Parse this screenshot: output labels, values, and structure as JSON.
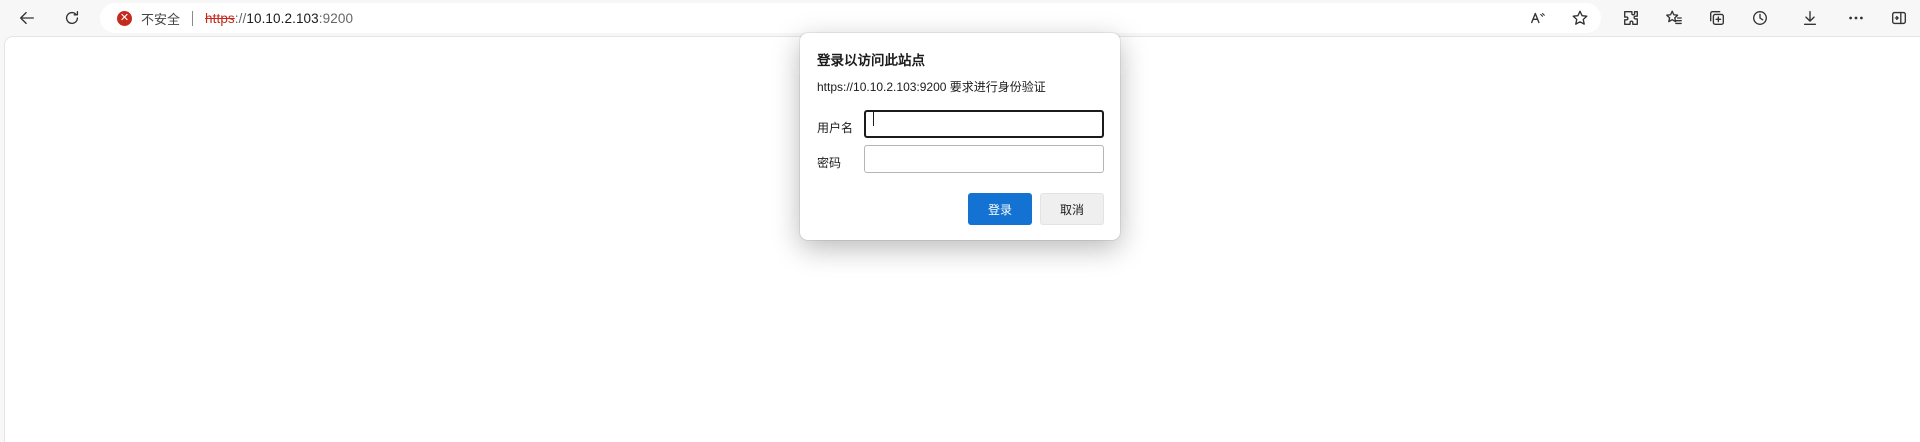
{
  "toolbar": {
    "back": "back-arrow-icon",
    "refresh": "refresh-icon",
    "icons": [
      "read-aloud-icon",
      "favorite-star-icon",
      "extensions-icon",
      "favorites-icon",
      "collections-icon",
      "history-icon",
      "downloads-icon",
      "more-icon",
      "sidebar-icon"
    ]
  },
  "address_bar": {
    "security_label": "不安全",
    "url_scheme": "https",
    "url_sep": "://",
    "url_host": "10.10.2.103",
    "url_port": ":9200",
    "warn_color": "#c42b1c"
  },
  "dialog": {
    "title": "登录以访问此站点",
    "subtitle": "https://10.10.2.103:9200 要求进行身份验证",
    "username_label": "用户名",
    "username_value": "",
    "password_label": "密码",
    "password_value": "",
    "login_button": "登录",
    "cancel_button": "取消",
    "accent": "#1473d2"
  }
}
